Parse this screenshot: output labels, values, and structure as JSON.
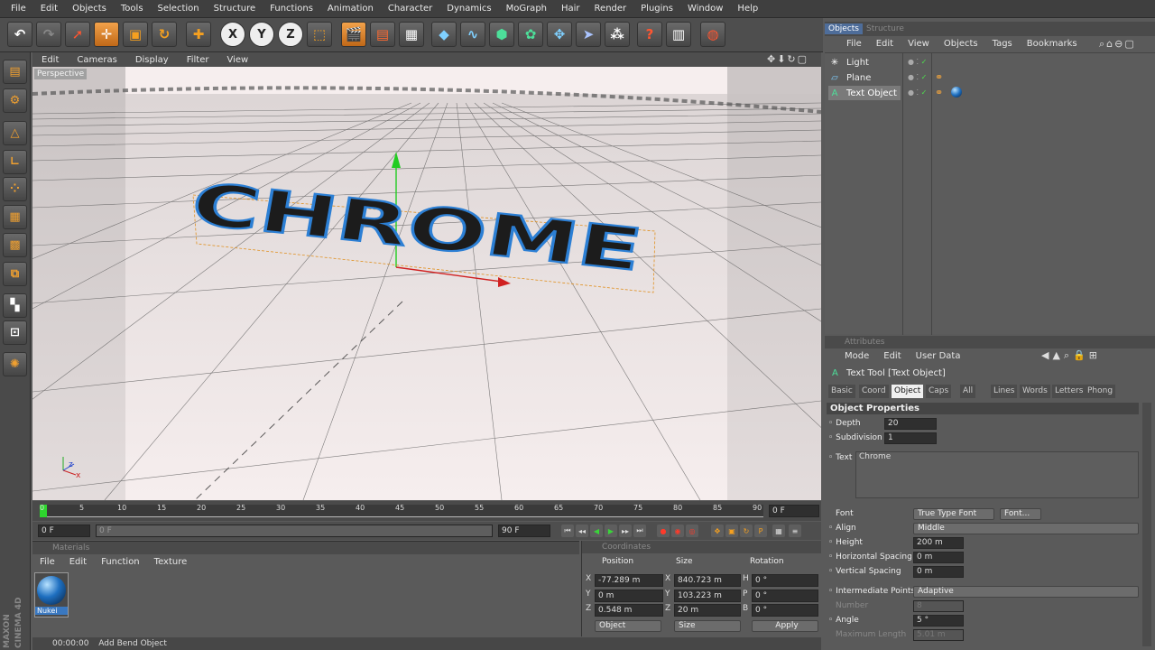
{
  "menubar": [
    "File",
    "Edit",
    "Objects",
    "Tools",
    "Selection",
    "Structure",
    "Functions",
    "Animation",
    "Character",
    "Dynamics",
    "MoGraph",
    "Hair",
    "Render",
    "Plugins",
    "Window",
    "Help"
  ],
  "toolbar": {
    "undo": "undo-icon",
    "redo": "redo-icon",
    "select": "arrow-icon",
    "move": "move-icon",
    "scale": "scale-icon",
    "rotate": "rotate-icon",
    "add": "plus-icon",
    "x_axis": "X",
    "y_axis": "Y",
    "z_axis": "Z",
    "coord": "coordinate-system-icon",
    "render_view": "clapboard-icon",
    "render_picture": "clapboard-red-icon",
    "render_settings": "clapboard-gear-icon",
    "cube": "cube-icon",
    "spline": "spline-icon",
    "nurbs": "nurbs-icon",
    "array": "array-icon",
    "deformer": "deformer-icon",
    "camera": "camera-icon",
    "light": "light-icon",
    "help": "help-icon",
    "table": "table-icon",
    "globe": "globe-icon"
  },
  "viewport": {
    "menu": [
      "Edit",
      "Cameras",
      "Display",
      "Filter",
      "View"
    ],
    "label": "Perspective",
    "text3d": "CHROME"
  },
  "timeline": {
    "ticks": [
      "0",
      "5",
      "10",
      "15",
      "20",
      "25",
      "30",
      "35",
      "40",
      "45",
      "50",
      "55",
      "60",
      "65",
      "70",
      "75",
      "80",
      "85",
      "90"
    ],
    "current_frame": "0 F",
    "start_field": "0 F",
    "min_field": "0 F",
    "max_field": "90 F",
    "end_field": "90 F"
  },
  "materials": {
    "title": "Materials",
    "menu": [
      "File",
      "Edit",
      "Function",
      "Texture"
    ],
    "items": [
      {
        "name": "Nukei",
        "color": "#1e6fc0"
      }
    ]
  },
  "coordinates": {
    "title": "Coordinates",
    "headers": [
      "Position",
      "Size",
      "Rotation"
    ],
    "rows": [
      {
        "axis": "X",
        "pos": "-77.289 m",
        "sizeaxis": "X",
        "size": "840.723 m",
        "rotaxis": "H",
        "rot": "0 °"
      },
      {
        "axis": "Y",
        "pos": "0 m",
        "sizeaxis": "Y",
        "size": "103.223 m",
        "rotaxis": "P",
        "rot": "0 °"
      },
      {
        "axis": "Z",
        "pos": "0.548 m",
        "sizeaxis": "Z",
        "size": "20 m",
        "rotaxis": "B",
        "rot": "0 °"
      }
    ],
    "mode1": "Object",
    "mode2": "Size",
    "apply": "Apply"
  },
  "status": {
    "time": "00:00:00",
    "message": "Add Bend Object"
  },
  "objects_panel": {
    "tabs": [
      "Objects",
      "Structure"
    ],
    "menu": [
      "File",
      "Edit",
      "View",
      "Objects",
      "Tags",
      "Bookmarks"
    ],
    "items": [
      {
        "name": "Light",
        "icon": "light-icon"
      },
      {
        "name": "Plane",
        "icon": "plane-icon"
      },
      {
        "name": "Text Object",
        "icon": "text-object-icon"
      }
    ]
  },
  "attributes": {
    "title": "Attributes",
    "menu": [
      "Mode",
      "Edit",
      "User Data"
    ],
    "object_title": "Text Tool [Text Object]",
    "tabs": [
      "Basic",
      "Coord",
      "Object",
      "Caps",
      "All",
      "Lines",
      "Words",
      "Letters",
      "Phong"
    ],
    "active_tab": "Object",
    "section": "Object Properties",
    "depth_label": "Depth",
    "depth": "20",
    "subdivision_label": "Subdivision",
    "subdivision": "1",
    "text_label": "Text",
    "text": "Chrome",
    "font_label": "Font",
    "font_type": "True Type Font",
    "font_button": "Font...",
    "align_label": "Align",
    "align": "Middle",
    "height_label": "Height",
    "height": "200 m",
    "hspacing_label": "Horizontal Spacing",
    "hspacing": "0 m",
    "vspacing_label": "Vertical Spacing",
    "vspacing": "0 m",
    "intermediate_label": "Intermediate Points",
    "intermediate": "Adaptive",
    "number_label": "Number",
    "number": "8",
    "angle_label": "Angle",
    "angle": "5 °",
    "maxlen_label": "Maximum Length",
    "maxlen": "5.01 m"
  },
  "brand": "MAXON CINEMA 4D"
}
